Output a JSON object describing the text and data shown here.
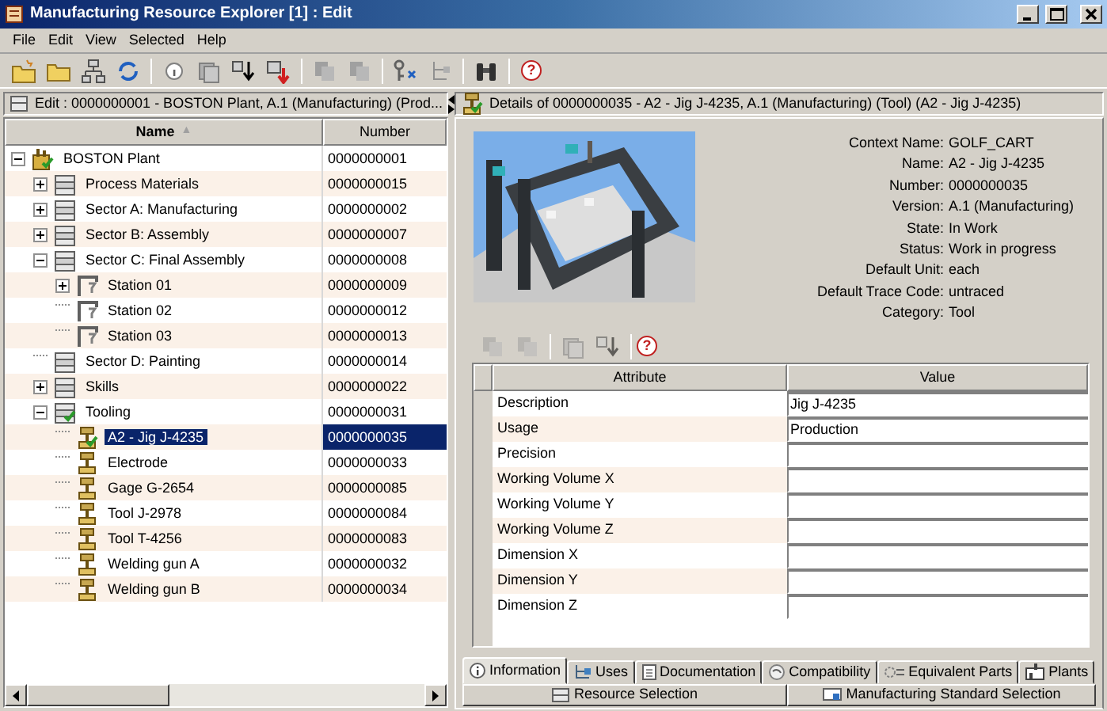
{
  "window": {
    "title": "Manufacturing Resource Explorer [1] : Edit"
  },
  "menu": [
    "File",
    "Edit",
    "View",
    "Selected",
    "Help"
  ],
  "toolbar": {
    "help": "?"
  },
  "left_pane": {
    "header": "Edit : 0000000001 - BOSTON Plant, A.1 (Manufacturing) (Prod...",
    "columns": [
      {
        "label": "Name",
        "sort_indicator": "▲"
      },
      {
        "label": "Number"
      }
    ],
    "tree": [
      {
        "name": "BOSTON Plant",
        "number": "0000000001",
        "kind": "plant",
        "checked_out": true,
        "expanded": true,
        "selected": false,
        "children": [
          {
            "name": "Process Materials",
            "number": "0000000015",
            "kind": "sector",
            "checked_out": false,
            "expanded": false,
            "selected": false
          },
          {
            "name": "Sector A: Manufacturing",
            "number": "0000000002",
            "kind": "sector",
            "checked_out": false,
            "expanded": false,
            "selected": false
          },
          {
            "name": "Sector B: Assembly",
            "number": "0000000007",
            "kind": "sector",
            "checked_out": false,
            "expanded": false,
            "selected": false
          },
          {
            "name": "Sector C: Final Assembly",
            "number": "0000000008",
            "kind": "sector",
            "checked_out": false,
            "expanded": true,
            "selected": false,
            "children": [
              {
                "name": "Station 01",
                "number": "0000000009",
                "kind": "station",
                "checked_out": false,
                "expanded": false,
                "selected": false
              },
              {
                "name": "Station 02",
                "number": "0000000012",
                "kind": "station",
                "checked_out": false,
                "selected": false
              },
              {
                "name": "Station 03",
                "number": "0000000013",
                "kind": "station",
                "checked_out": false,
                "selected": false
              }
            ]
          },
          {
            "name": "Sector D: Painting",
            "number": "0000000014",
            "kind": "sector",
            "checked_out": false,
            "selected": false
          },
          {
            "name": "Skills",
            "number": "0000000022",
            "kind": "sector",
            "checked_out": false,
            "expanded": false,
            "selected": false
          },
          {
            "name": "Tooling",
            "number": "0000000031",
            "kind": "sector",
            "checked_out": true,
            "expanded": true,
            "selected": false,
            "children": [
              {
                "name": "A2 - Jig J-4235",
                "number": "0000000035",
                "kind": "tool",
                "checked_out": true,
                "selected": true
              },
              {
                "name": "Electrode",
                "number": "0000000033",
                "kind": "tool",
                "checked_out": false,
                "selected": false
              },
              {
                "name": "Gage G-2654",
                "number": "0000000085",
                "kind": "tool",
                "checked_out": false,
                "selected": false
              },
              {
                "name": "Tool J-2978",
                "number": "0000000084",
                "kind": "tool",
                "checked_out": false,
                "selected": false
              },
              {
                "name": "Tool T-4256",
                "number": "0000000083",
                "kind": "tool",
                "checked_out": false,
                "selected": false
              },
              {
                "name": "Welding gun A",
                "number": "0000000032",
                "kind": "tool",
                "checked_out": false,
                "selected": false
              },
              {
                "name": "Welding gun B",
                "number": "0000000034",
                "kind": "tool",
                "checked_out": false,
                "selected": false
              }
            ]
          }
        ]
      }
    ]
  },
  "details": {
    "header": "Details of 0000000035 - A2 - Jig J-4235, A.1 (Manufacturing) (Tool) (A2 - Jig J-4235)",
    "properties": [
      {
        "label": "Context Name:",
        "value": "GOLF_CART"
      },
      {
        "label": "Name:",
        "value": "A2 - Jig J-4235"
      },
      {
        "label": "Number:",
        "value": "0000000035"
      },
      {
        "label": "Version:",
        "value": "A.1 (Manufacturing)"
      },
      {
        "label": "State:",
        "value": "In Work"
      },
      {
        "label": "Status:",
        "value": "Work in progress"
      },
      {
        "label": "Default Unit:",
        "value": "each"
      },
      {
        "label": "Default Trace Code:",
        "value": "untraced"
      },
      {
        "label": "Category:",
        "value": "Tool"
      }
    ],
    "toolbar": {
      "help": "?"
    },
    "attributes": {
      "columns": [
        "Attribute",
        "Value"
      ],
      "rows": [
        {
          "attribute": "Description",
          "value": "Jig J-4235"
        },
        {
          "attribute": "Usage",
          "value": "Production"
        },
        {
          "attribute": "Precision"
        },
        {
          "attribute": "Working Volume X"
        },
        {
          "attribute": "Working Volume Y"
        },
        {
          "attribute": "Working Volume Z"
        },
        {
          "attribute": "Dimension X"
        },
        {
          "attribute": "Dimension Y"
        },
        {
          "attribute": "Dimension Z"
        }
      ]
    },
    "tabs": [
      {
        "label": "Information",
        "kind": "info",
        "selected": true
      },
      {
        "label": "Uses",
        "kind": "uses",
        "selected": false
      },
      {
        "label": "Documentation",
        "kind": "document",
        "selected": false
      },
      {
        "label": "Compatibility",
        "kind": "compat",
        "selected": false
      },
      {
        "label": "Equivalent Parts",
        "kind": "equivalent",
        "selected": false
      },
      {
        "label": "Plants",
        "kind": "plant",
        "selected": false
      }
    ],
    "bottom_tabs": [
      {
        "label": "Resource Selection",
        "kind": "resource",
        "selected": false
      },
      {
        "label": "Manufacturing Standard Selection",
        "kind": "standard",
        "selected": false
      }
    ]
  }
}
